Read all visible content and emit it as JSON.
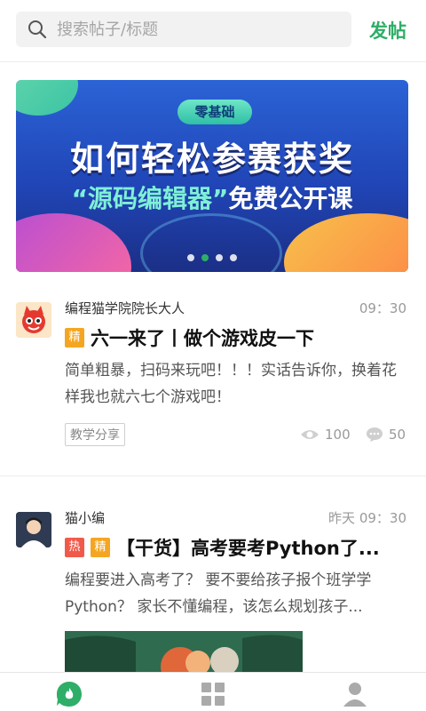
{
  "search": {
    "placeholder": "搜索帖子/标题"
  },
  "header": {
    "post_label": "发帖"
  },
  "banner": {
    "tag": "零基础",
    "title_line1": "如何轻松参赛获奖",
    "title_line2_highlight": "“源码编辑器”",
    "title_line2_rest": "免费公开课",
    "dot_count": 4,
    "active_dot": 1
  },
  "posts": [
    {
      "author": "编程猫学院院长大人",
      "time": "09：30",
      "badges": [
        "精"
      ],
      "title": "六一来了丨做个游戏皮一下",
      "excerpt": "简单粗暴，扫码来玩吧！！！实话告诉你，换着花样我也就六七个游戏吧！",
      "category": "教学分享",
      "views": "100",
      "comments": "50"
    },
    {
      "author": "猫小编",
      "time": "昨天 09：30",
      "badges": [
        "热",
        "精"
      ],
      "title": "【干货】高考要考Python了...",
      "excerpt": "编程要进入高考了？ 要不要给孩子报个班学学Python？ 家长不懂编程，该怎么规划孩子..."
    }
  ],
  "icons": {
    "search": "search-icon",
    "views": "eye-icon",
    "comments": "comment-icon",
    "tab_home": "flame-chat-icon",
    "tab_apps": "grid-icon",
    "tab_profile": "person-icon"
  },
  "colors": {
    "accent": "#2eae67",
    "badge_jing": "#f4a623",
    "badge_re": "#f05a4b"
  }
}
